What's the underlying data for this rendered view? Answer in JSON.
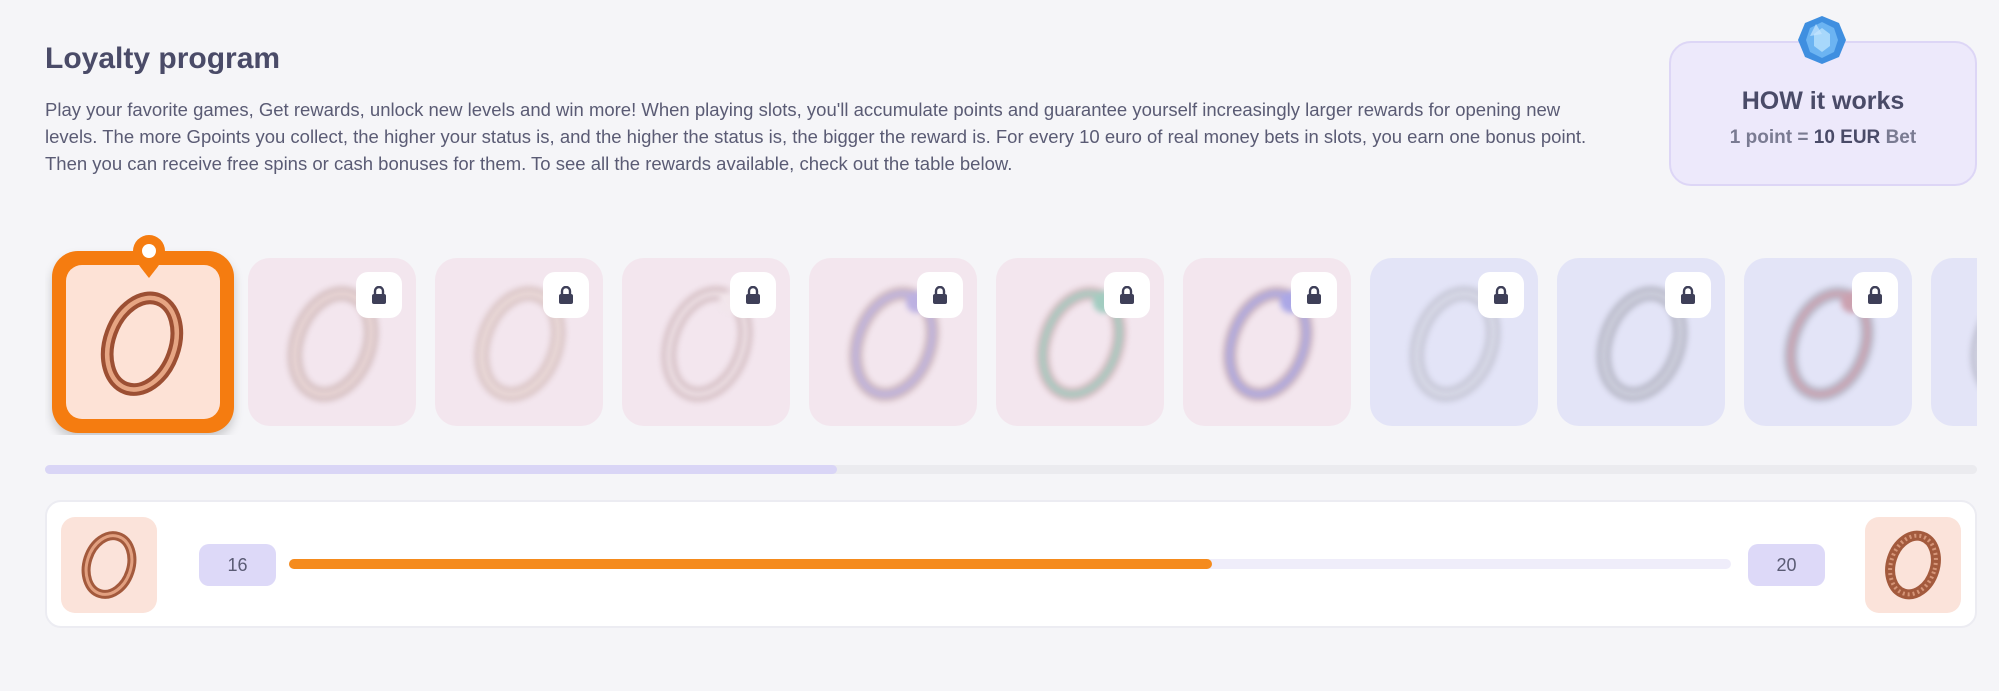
{
  "header": {
    "title": "Loyalty program",
    "description": "Play your favorite games, Get rewards, unlock new levels and win more! When playing slots, you'll accumulate points and guarantee yourself increasingly larger rewards for opening new levels. The more Gpoints you collect, the higher your status is, and the higher the status is, the bigger the reward is. For every 10 euro of real money bets in slots, you earn one bonus point. Then you can receive free spins or cash bonuses for them. To see all the rewards available, check out the table below."
  },
  "how_it_works": {
    "title": "HOW it works",
    "points": "1 point",
    "equals": "=",
    "amount": "10 EUR",
    "suffix": "Bet"
  },
  "levels": {
    "current_index": 0,
    "cards": [
      {
        "state": "active",
        "tint": "orange",
        "ring": "copper"
      },
      {
        "state": "locked",
        "tint": "pink",
        "ring": "rose"
      },
      {
        "state": "locked",
        "tint": "pink",
        "ring": "rose-engraved"
      },
      {
        "state": "locked",
        "tint": "pink",
        "ring": "rose-pearl"
      },
      {
        "state": "locked",
        "tint": "pink",
        "ring": "rose-amethyst"
      },
      {
        "state": "locked",
        "tint": "pink",
        "ring": "rose-emerald"
      },
      {
        "state": "locked",
        "tint": "pink",
        "ring": "rose-sapphire"
      },
      {
        "state": "locked",
        "tint": "blue",
        "ring": "silver"
      },
      {
        "state": "locked",
        "tint": "blue",
        "ring": "silver-dark"
      },
      {
        "state": "locked",
        "tint": "blue",
        "ring": "silver-ruby"
      },
      {
        "state": "locked",
        "tint": "blue",
        "ring": "silver-partial"
      }
    ],
    "scroll_fraction": 0.41
  },
  "progress": {
    "current_points": "16",
    "target_points": "20",
    "fraction": 0.64
  },
  "colors": {
    "accent": "#f57c10",
    "progress": "#f58b1d",
    "lavender": "#ddd9f8"
  }
}
